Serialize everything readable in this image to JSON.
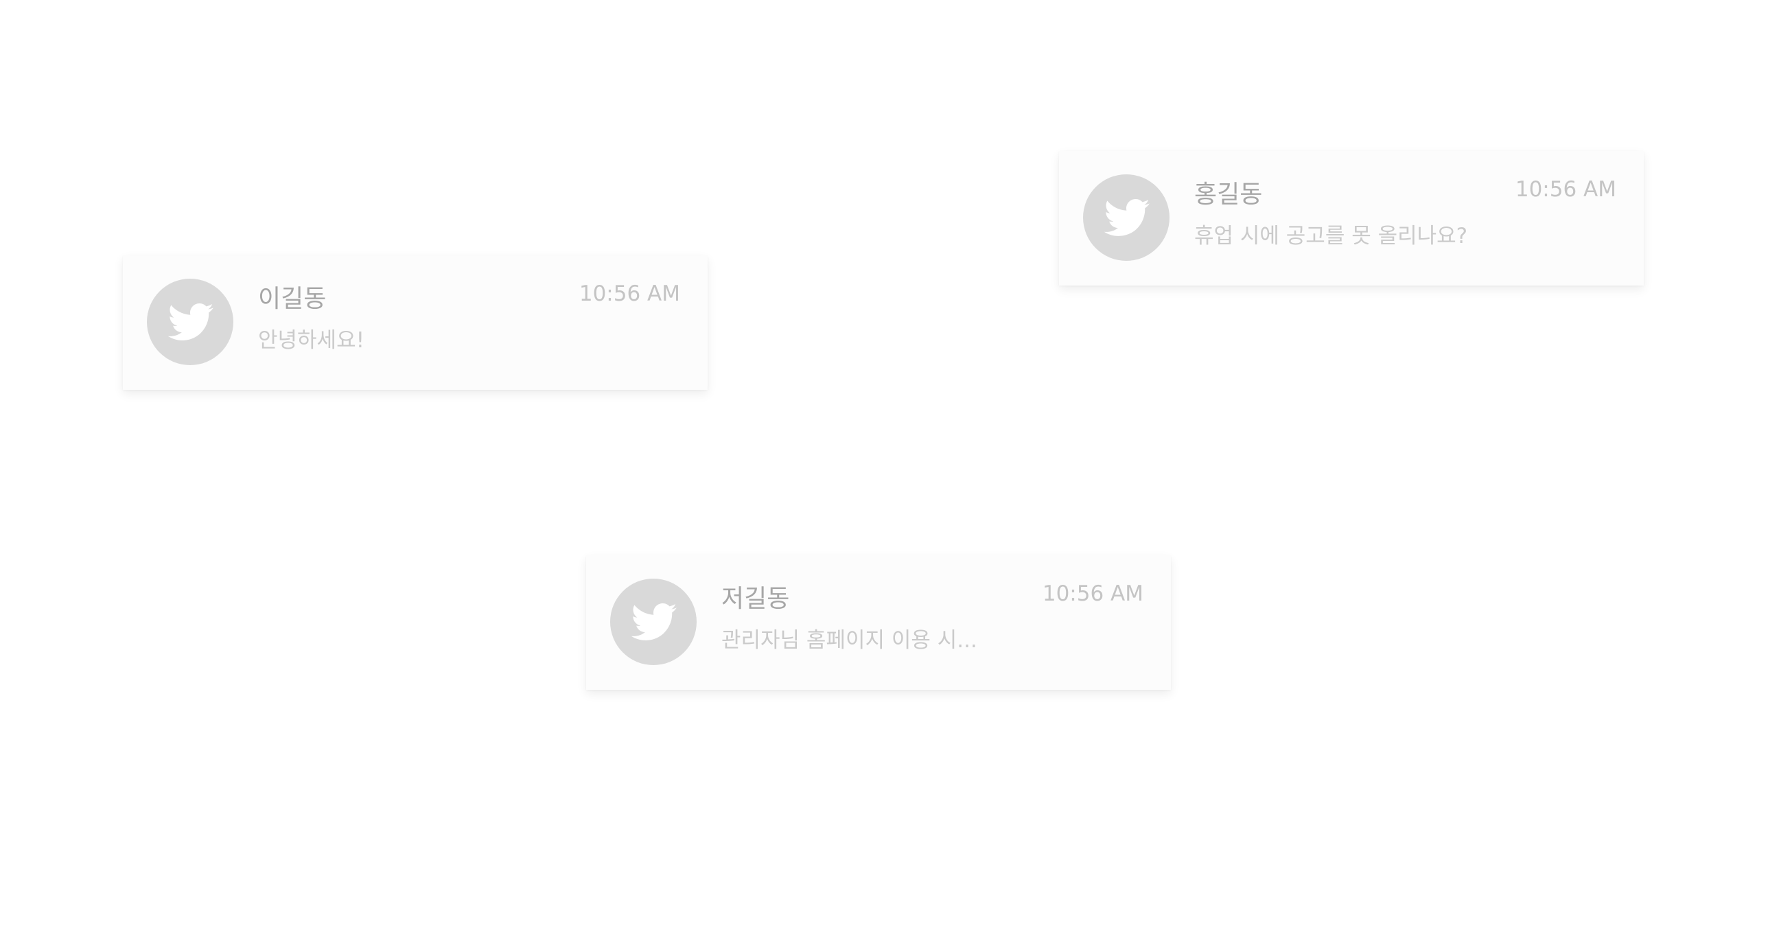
{
  "icon": "twitter-bird-icon",
  "colors": {
    "card_bg": "#fcfcfc",
    "avatar_bg": "#d9d9d9",
    "name_text": "#a6a6a6",
    "time_text": "#c4c4c4",
    "message_text": "#cacaca"
  },
  "notifications": [
    {
      "name": "홍길동",
      "time": "10:56 AM",
      "message": "휴업 시에 공고를 못 올리나요?"
    },
    {
      "name": "이길동",
      "time": "10:56 AM",
      "message": "안녕하세요!"
    },
    {
      "name": "저길동",
      "time": "10:56 AM",
      "message": "관리자님 홈페이지 이용 시..."
    }
  ]
}
